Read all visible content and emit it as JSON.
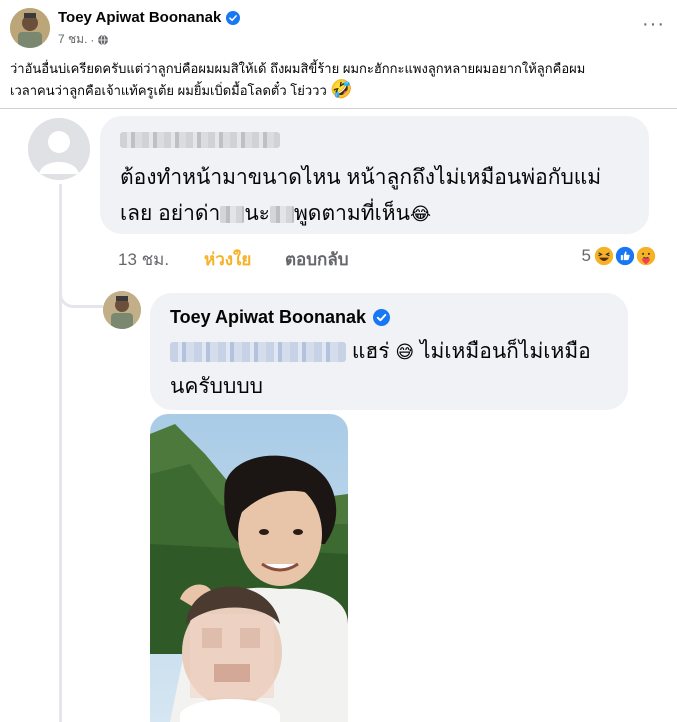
{
  "post": {
    "author": "Toey Apiwat Boonanak",
    "time": "7 ชม.",
    "separator": "·",
    "more_icon": "more-horizontal-icon",
    "text_line1": "ว่าอันอื่นบ่เครียดครับแต่ว่าลูกบ่คือผมผมสิให้เด้ ถึงผมสิขี้ร้าย ผมกะฮักกะแพงลูกหลายผมอยากให้ลูกคือผม",
    "text_line2": "เวลาคนว่าลูกคือเจ้าแท้ครูเต้ย ผมยิ้มเบิ่ดมื้อโลดตั๋ว โย่ววว",
    "text_emoji": "🤣"
  },
  "comment": {
    "text_part1": "ต้องทำหน้ามาขนาดไหน หน้าลูกถึงไม่เหมือนพ่อกับแม่",
    "text_part2": "เลย อย่าด่า",
    "text_part3": "นะ",
    "text_part4": "พูดตามที่เห็น",
    "text_emoji": "😂",
    "time": "13 ชม.",
    "like_label": "ห่วงใย",
    "reply_label": "ตอบกลับ",
    "reaction_count": "5",
    "reaction_colors": {
      "haha": "#f7b125",
      "like": "#1877f2",
      "care": "#f7b125"
    }
  },
  "reply": {
    "author": "Toey Apiwat Boonanak",
    "text_part1": "แฮร่",
    "text_emoji": "😅",
    "text_part2": "ไม่เหมือนก็ไม่เหมือ",
    "text_line2": "นครับบบบ"
  },
  "colors": {
    "verified": "#1877f2",
    "bubble": "#f0f2f5",
    "meta_text": "#65676b",
    "like_active": "#f7b125"
  }
}
